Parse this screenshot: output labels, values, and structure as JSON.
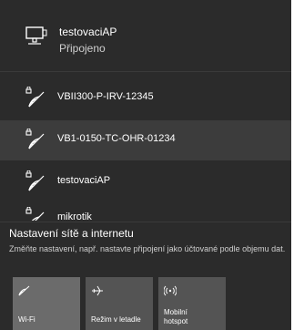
{
  "connected": {
    "name": "testovaciAP",
    "status": "Připojeno",
    "icon": "ethernet-icon"
  },
  "networks": [
    {
      "name": "VBII300-P-IRV-12345",
      "icon": "wifi-secured-icon"
    },
    {
      "name": "VB1-0150-TC-OHR-01234",
      "icon": "wifi-secured-icon"
    },
    {
      "name": "testovaciAP",
      "icon": "wifi-secured-icon"
    },
    {
      "name": "mikrotik",
      "icon": "wifi-secured-icon"
    }
  ],
  "settings": {
    "title": "Nastavení sítě a internetu",
    "description": "Změňte nastavení, např. nastavte připojení jako účtované podle objemu dat."
  },
  "quick_actions": {
    "wifi_label": "Wi-Fi",
    "airplane_label": "Režim v letadle",
    "hotspot_label_1": "Mobilní",
    "hotspot_label_2": "hotspot"
  },
  "colors": {
    "flyout_bg": "#2b2b2b",
    "hover_bg": "#3c3c3c",
    "tile_bg": "#545454",
    "tile_active_bg": "#6b6b6b"
  }
}
